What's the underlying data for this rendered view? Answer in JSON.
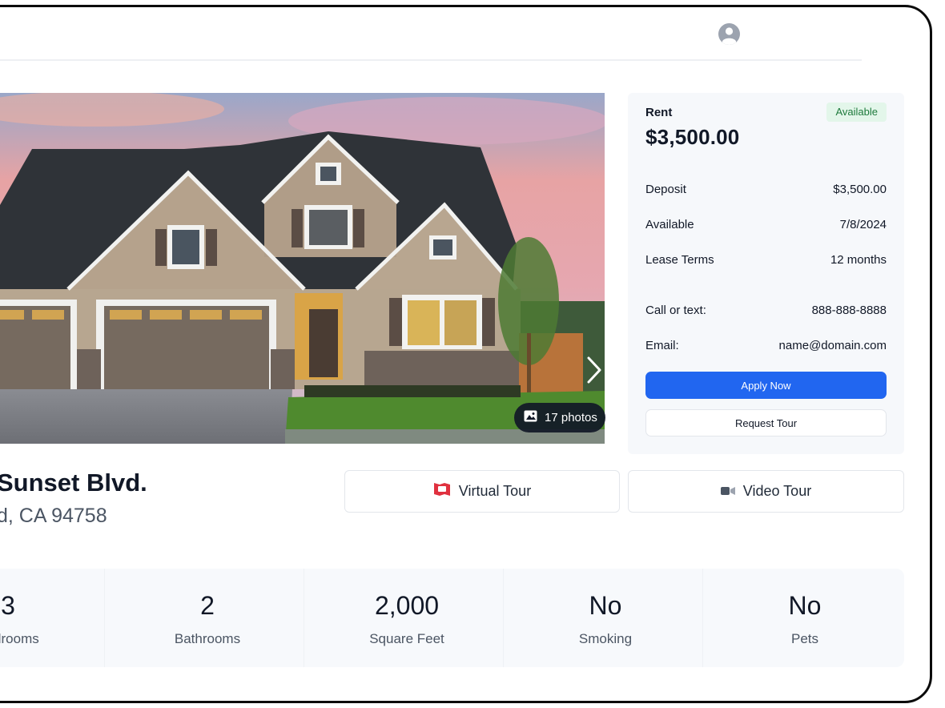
{
  "listing": {
    "street": "Sunset Blvd.",
    "city_line": "d, CA 94758",
    "photos_label": "17 photos"
  },
  "pricing": {
    "rent_label": "Rent",
    "status_badge": "Available",
    "rent_value": "$3,500.00",
    "rows": [
      {
        "label": "Deposit",
        "value": "$3,500.00"
      },
      {
        "label": "Available",
        "value": "7/8/2024"
      },
      {
        "label": "Lease Terms",
        "value": "12 months"
      }
    ],
    "contact": [
      {
        "label": "Call or text:",
        "value": "888-888-8888"
      },
      {
        "label": "Email:",
        "value": "name@domain.com"
      }
    ],
    "apply_label": "Apply Now",
    "request_label": "Request Tour"
  },
  "tours": {
    "virtual_label": "Virtual Tour",
    "video_label": "Video Tour"
  },
  "stats": [
    {
      "value": "3",
      "label": "Bedrooms"
    },
    {
      "value": "2",
      "label": "Bathrooms"
    },
    {
      "value": "2,000",
      "label": "Square Feet"
    },
    {
      "value": "No",
      "label": "Smoking"
    },
    {
      "value": "No",
      "label": "Pets"
    }
  ],
  "colors": {
    "accent": "#2166f0",
    "badge_bg": "#e3f6ea",
    "badge_text": "#1e7a3c",
    "virtual_tour_icon": "#e0313f"
  },
  "icons": {
    "profile": "user-circle-icon",
    "next": "chevron-right-icon",
    "photos": "image-icon",
    "virtual_tour": "virtual-tour-icon",
    "video": "video-camera-icon"
  }
}
